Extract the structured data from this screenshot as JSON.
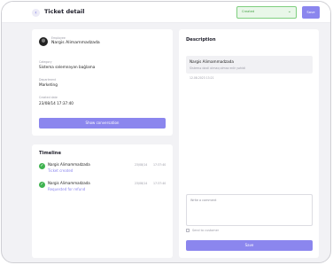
{
  "header": {
    "back_icon": "chevron-left-icon",
    "title": "Ticket detail",
    "status_value": "Created",
    "status_chevron": "chevron-down-icon",
    "save_label": "Save",
    "colors": {
      "accent": "#8b86ee",
      "status": "#49a349"
    }
  },
  "info": {
    "employee_label": "Employee",
    "employee_name": "Nargis Alimammadzada",
    "category_label": "Category",
    "category_value": "Sistema səlemnəyən bağlama",
    "department_label": "Department",
    "department_value": "Marketing",
    "created_label": "Created date",
    "created_value": "23/08/14  17:37:40",
    "show_conversation_label": "Show conversation"
  },
  "timeline": {
    "title": "Timeline",
    "items": [
      {
        "name": "Nargis Alimammadzada",
        "action": "Ticket created",
        "date": "23/08/14",
        "time": "17:37:40"
      },
      {
        "name": "Nargis Alimammadzada",
        "action": "Requested for refund",
        "date": "23/08/14",
        "time": "17:37:40"
      }
    ]
  },
  "description": {
    "title": "Description",
    "author": "Nargis Alimammadzada",
    "message": "Sistemə daxil olmaq olmaz edir yəhidi",
    "date": "12.08.2023  13:21",
    "comment_placeholder": "Write a comment",
    "send_label": "Send to customer",
    "save_label": "Save"
  }
}
